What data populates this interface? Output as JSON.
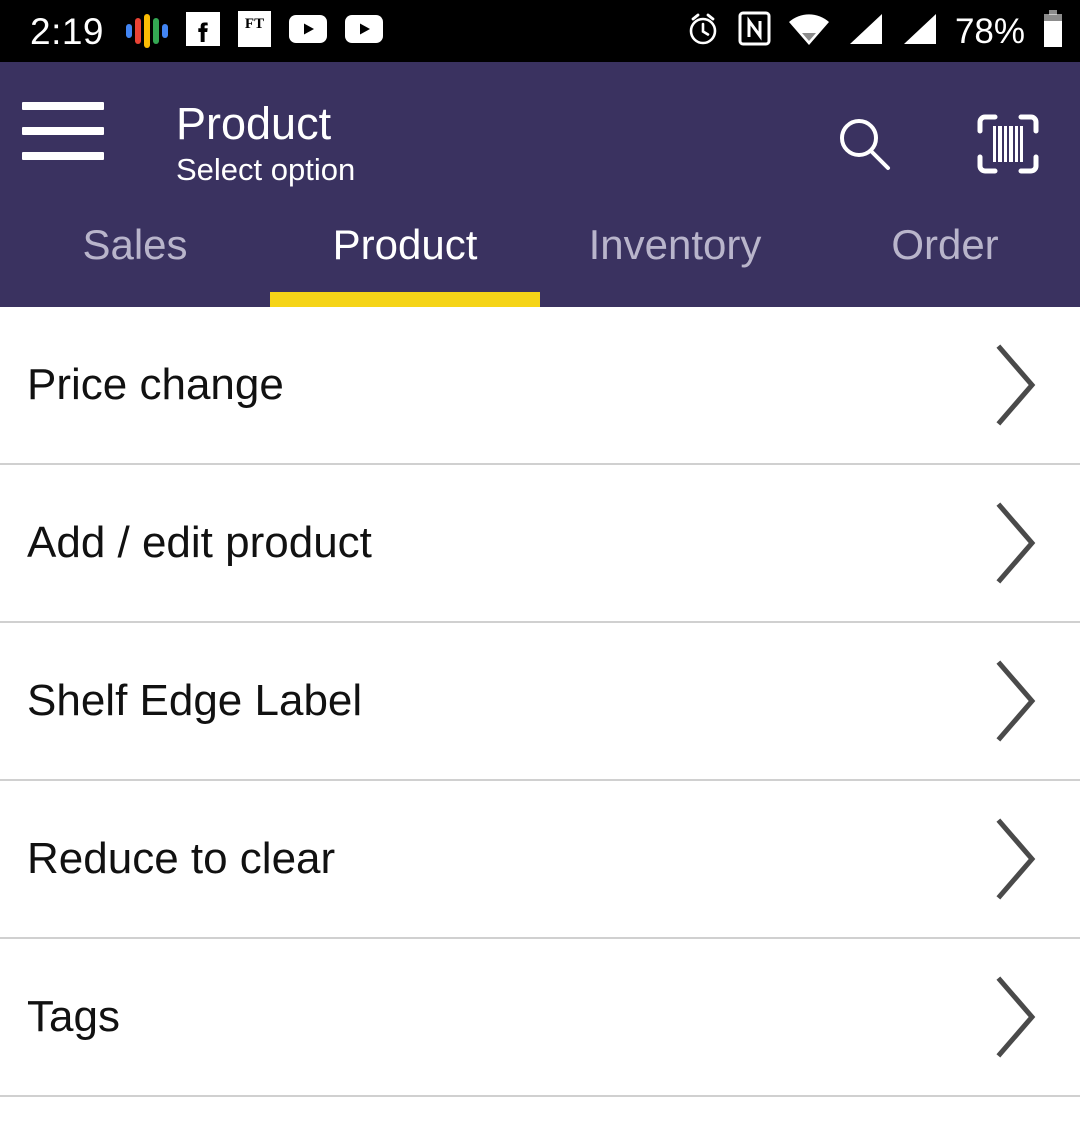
{
  "status_bar": {
    "time": "2:19",
    "battery_percent": "78%",
    "left_icons": [
      {
        "name": "google-podcasts-icon"
      },
      {
        "name": "facebook-icon",
        "label": "f"
      },
      {
        "name": "financial-times-icon",
        "label": "FT"
      },
      {
        "name": "youtube-icon"
      },
      {
        "name": "youtube-icon"
      }
    ],
    "right_icons": [
      {
        "name": "alarm-clock-icon"
      },
      {
        "name": "nfc-icon",
        "label": "N"
      },
      {
        "name": "wifi-icon"
      },
      {
        "name": "signal-bars-icon"
      },
      {
        "name": "signal-bars-icon"
      },
      {
        "name": "battery-icon"
      }
    ],
    "colors": {
      "background": "#000000",
      "foreground": "#ffffff"
    }
  },
  "header": {
    "menu_icon": "hamburger-menu-icon",
    "title": "Product",
    "subtitle": "Select option",
    "actions": [
      {
        "name": "search-icon",
        "label": "Search"
      },
      {
        "name": "barcode-scan-icon",
        "label": "Scan barcode"
      }
    ],
    "colors": {
      "background": "#3a3260",
      "accent": "#f5d418",
      "text": "#ffffff",
      "inactive_text": "#b9b5cb"
    }
  },
  "tabs": {
    "active_index": 1,
    "items": [
      {
        "label": "Sales"
      },
      {
        "label": "Product"
      },
      {
        "label": "Inventory"
      },
      {
        "label": "Order"
      }
    ]
  },
  "list": {
    "items": [
      {
        "label": "Price change",
        "chevron": "chevron-right-icon"
      },
      {
        "label": "Add / edit product",
        "chevron": "chevron-right-icon"
      },
      {
        "label": "Shelf Edge Label",
        "chevron": "chevron-right-icon"
      },
      {
        "label": "Reduce to clear",
        "chevron": "chevron-right-icon"
      },
      {
        "label": "Tags",
        "chevron": "chevron-right-icon"
      }
    ],
    "colors": {
      "background": "#ffffff",
      "text": "#111111",
      "divider": "#d0d0d0",
      "chevron": "#4a4a4a"
    }
  }
}
